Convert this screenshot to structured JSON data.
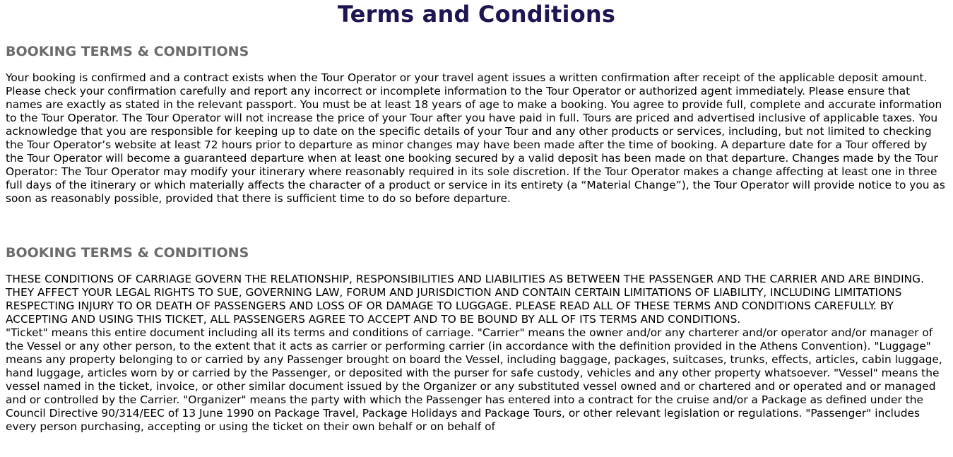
{
  "page": {
    "title": "Terms and Conditions"
  },
  "sections": [
    {
      "heading": "BOOKING TERMS & CONDITIONS",
      "paragraphs": [
        "Your booking is confirmed and a contract exists when the Tour Operator or your travel agent issues a written confirmation after receipt of the applicable deposit amount. Please check your confirmation carefully and report any incorrect or incomplete information to the Tour Operator or authorized agent immediately. Please ensure that names are exactly as stated in the relevant passport. You must be at least 18 years of age to make a booking. You agree to provide full, complete and accurate information to the Tour Operator. The Tour Operator will not increase the price of your Tour after you have paid in full. Tours are priced and advertised inclusive of applicable taxes. You acknowledge that you are responsible for keeping up to date on the specific details of your Tour and any other products or services, including, but not limited to checking the Tour Operator’s website at least 72 hours prior to departure as minor changes may have been made after the time of booking. A departure date for a Tour offered by the Tour Operator will become a guaranteed departure when at least one booking secured by a valid deposit has been made on that departure. Changes made by the Tour Operator: The Tour Operator may modify your itinerary where reasonably required in its sole discretion. If the Tour Operator makes a change affecting at least one in three full days of the itinerary or which materially affects the character of a product or service in its entirety (a “Material Change”), the Tour Operator will provide notice to you as soon as reasonably possible, provided that there is sufficient time to do so before departure."
      ]
    },
    {
      "heading": "BOOKING TERMS & CONDITIONS",
      "paragraphs": [
        "THESE CONDITIONS OF CARRIAGE GOVERN THE RELATIONSHIP, RESPONSIBILITIES AND LIABILITIES AS BETWEEN THE PASSENGER AND THE CARRIER AND ARE BINDING. THEY AFFECT YOUR LEGAL RIGHTS TO SUE, GOVERNING LAW, FORUM AND JURISDICTION AND CONTAIN CERTAIN LIMITATIONS OF LIABILITY, INCLUDING LIMITATIONS RESPECTING INJURY TO OR DEATH OF PASSENGERS AND LOSS OF OR DAMAGE TO LUGGAGE. PLEASE READ ALL OF THESE TERMS AND CONDITIONS CAREFULLY. BY ACCEPTING AND USING THIS TICKET, ALL PASSENGERS AGREE TO ACCEPT AND TO BE BOUND BY ALL OF ITS TERMS AND CONDITIONS.",
        "\"Ticket\" means this entire document including all its terms and conditions of carriage. \"Carrier\" means the owner and/or any charterer and/or operator and/or manager of the Vessel or any other person, to the extent that it acts as carrier or performing carrier (in accordance with the definition provided in the Athens Convention). \"Luggage\" means any property belonging to or carried by any Passenger brought on board the Vessel, including baggage, packages, suitcases, trunks, effects, articles, cabin luggage, hand luggage, articles worn by or carried by the Passenger, or deposited with the purser for safe custody, vehicles and any other property whatsoever. \"Vessel\" means the vessel named in the ticket, invoice, or other similar document issued by the Organizer or any substituted vessel owned and or chartered and or operated and or managed and or controlled by the Carrier. \"Organizer\" means the party with which the Passenger has entered into a contract for the cruise and/or a Package as defined under the Council Directive 90/314/EEC of 13 June 1990 on Package Travel, Package Holidays and Package Tours, or other relevant legislation or regulations. \"Passenger\" includes every person purchasing, accepting or using the ticket on their own behalf or on behalf of"
      ]
    }
  ]
}
